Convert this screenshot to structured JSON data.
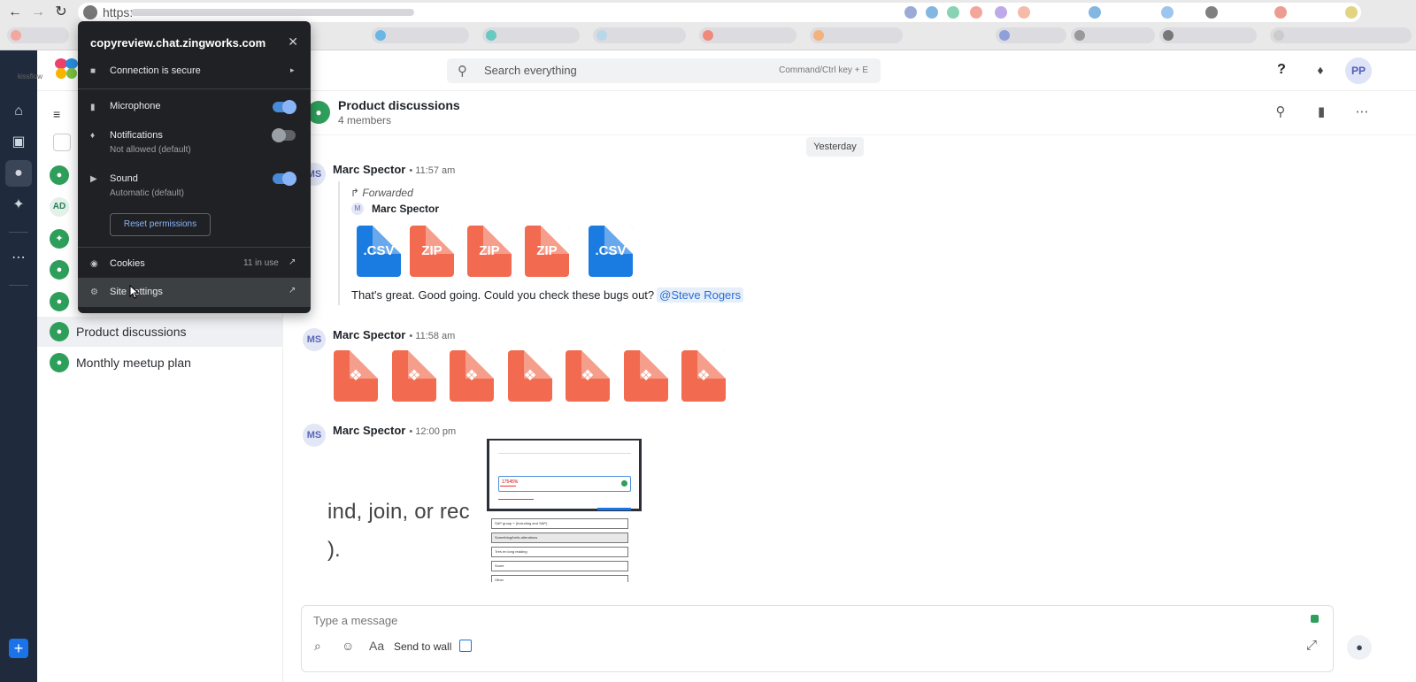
{
  "browser": {
    "url_scheme": "https:",
    "back_icon": "arrow-left-icon",
    "forward_icon": "arrow-right-icon",
    "reload_icon": "reload-icon",
    "lock_icon": "lock-icon"
  },
  "popup": {
    "host": "copyreview.chat.zingworks.com",
    "connection": "Connection is secure",
    "microphone": {
      "label": "Microphone",
      "state": "on"
    },
    "notifications": {
      "label": "Notifications",
      "sub": "Not allowed (default)",
      "state": "off"
    },
    "sound": {
      "label": "Sound",
      "sub": "Automatic (default)",
      "state": "on"
    },
    "reset": "Reset permissions",
    "cookies": {
      "label": "Cookies",
      "value": "11 in use"
    },
    "site_settings": "Site settings"
  },
  "app": {
    "logo_text": "kissflow",
    "search_placeholder": "Search everything",
    "search_hint": "Command/Ctrl key + E",
    "help": "?",
    "profile_initials": "PP",
    "accent": "#2e9e5b"
  },
  "sidebar": {
    "items": [
      {
        "label": "",
        "avatar": "group-icon"
      },
      {
        "label": "",
        "avatar": "AD"
      },
      {
        "label": "",
        "avatar": "group-icon"
      },
      {
        "label": "",
        "avatar": "group-icon"
      },
      {
        "label": "",
        "avatar": "group-icon"
      },
      {
        "label": "Product discussions",
        "avatar": "group-icon",
        "active": true
      },
      {
        "label": "Monthly meetup plan",
        "avatar": "group-icon"
      }
    ]
  },
  "chat": {
    "title": "Product discussions",
    "members": "4 members",
    "date_chip": "Yesterday",
    "messages": [
      {
        "initials": "MS",
        "author": "Marc Spector",
        "time": "• 11:57 am",
        "forwarded_label": "Forwarded",
        "forwarded_initial": "M",
        "forwarded_author": "Marc Spector",
        "files": [
          ".CSV",
          "ZIP",
          "ZIP",
          "ZIP",
          ".CSV"
        ],
        "text": "That's great. Good going. Could you check these bugs out?",
        "mention": "@Steve Rogers"
      },
      {
        "initials": "MS",
        "author": "Marc Spector",
        "time": "• 11:58 am",
        "file_count": 7
      },
      {
        "initials": "MS",
        "author": "Marc Spector",
        "time": "• 12:00 pm",
        "image_text_line1": "ind, join, or rec",
        "image_text_line2": ").",
        "options": [
          "SAP group + (Including and SAP)",
          "Something/hello alterations",
          "Tres en long reading",
          "Some",
          "Other"
        ],
        "field_value": "17545%"
      }
    ]
  },
  "composer": {
    "placeholder": "Type a message",
    "format_label": "Aa",
    "send_to_wall": "Send to wall"
  }
}
